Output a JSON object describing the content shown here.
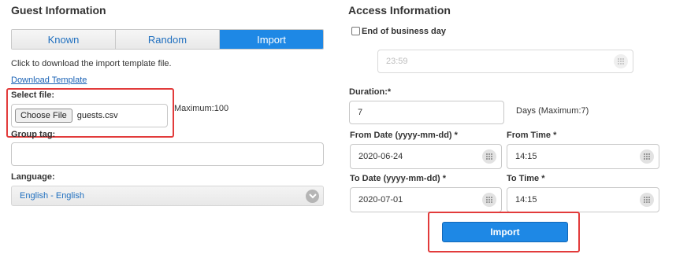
{
  "guest": {
    "heading": "Guest Information",
    "tabs": [
      {
        "label": "Known",
        "active": false
      },
      {
        "label": "Random",
        "active": false
      },
      {
        "label": "Import",
        "active": true
      }
    ],
    "import_hint": "Click to download the import template file.",
    "download_link": "Download Template",
    "select_file_label": "Select file:",
    "choose_file_button": "Choose File",
    "selected_file": "guests.csv",
    "max_note": "Maximum:100",
    "group_tag_label": "Group tag:",
    "group_tag_value": "",
    "language_label": "Language:",
    "language_value": "English - English"
  },
  "access": {
    "heading": "Access Information",
    "end_of_day_label": "End of business day",
    "end_of_day_checked": false,
    "end_time_placeholder": "23:59",
    "duration_label": "Duration:*",
    "duration_value": "7",
    "duration_note": "Days (Maximum:7)",
    "from_date_label": "From Date (yyyy-mm-dd) *",
    "from_date_value": "2020-06-24",
    "from_time_label": "From Time *",
    "from_time_value": "14:15",
    "to_date_label": "To Date (yyyy-mm-dd) *",
    "to_date_value": "2020-07-01",
    "to_time_label": "To Time *",
    "to_time_value": "14:15",
    "import_button": "Import"
  },
  "icons": {
    "calendar": "calendar-icon",
    "chevron": "chevron-down-icon"
  },
  "colors": {
    "accent": "#1e88e5",
    "highlight": "#e23b3b",
    "link": "#1a62b5"
  }
}
